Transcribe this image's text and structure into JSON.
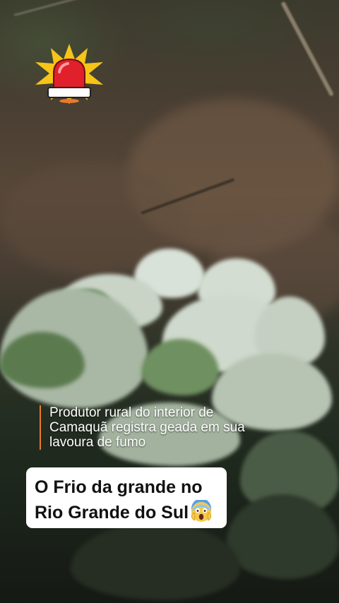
{
  "caption": {
    "lines": [
      "Produtor rural do interior de",
      "Camaquã registra geada em sua",
      "lavoura de fumo"
    ]
  },
  "title": {
    "line1": "O Frio da grande no",
    "line2": "Rio Grande do Sul"
  },
  "icons": {
    "alarm": "red-siren-alarm-icon",
    "emoji": "face-screaming-in-fear-icon"
  },
  "colors": {
    "accent_bar": "#e87a2c",
    "siren_red": "#e0202a",
    "siren_burst": "#f5c518",
    "title_bg": "#ffffff"
  }
}
